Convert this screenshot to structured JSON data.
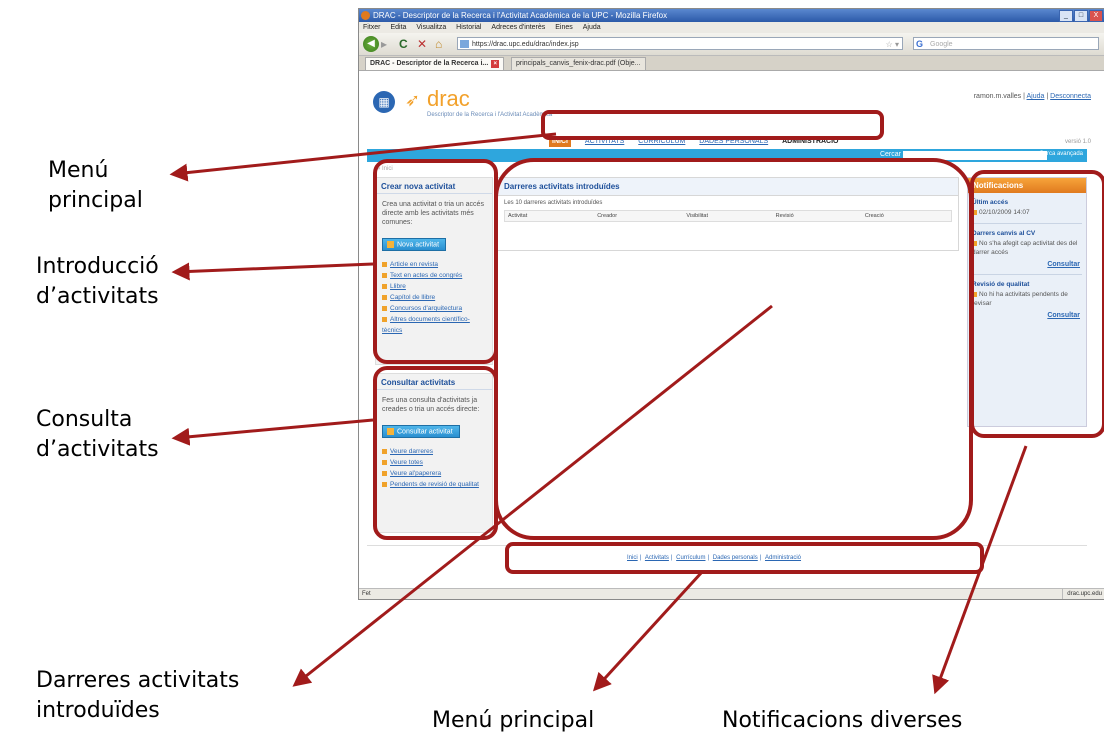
{
  "window": {
    "title": "DRAC - Descriptor de la Recerca i l'Activitat Acadèmica de la UPC - Mozilla Firefox",
    "controls": [
      "_",
      "□",
      "X"
    ]
  },
  "browser_menu": [
    "Fitxer",
    "Edita",
    "Visualitza",
    "Historial",
    "Adreces d'interès",
    "Eines",
    "Ajuda"
  ],
  "url": "https://drac.upc.edu/drac/index.jsp",
  "search_placeholder": "Google",
  "tabs": [
    {
      "label": "DRAC - Descriptor de la Recerca i..."
    },
    {
      "label": "principals_canvis_fenix-drac.pdf (Obje..."
    }
  ],
  "site": {
    "logo_text": "drac",
    "logo_subtitle": "Descriptor de la Recerca i l'Activitat Acadèmica",
    "top_links": {
      "user": "ramon.m.valles",
      "help": "Ajuda",
      "logout": "Desconnecta"
    },
    "nav": [
      "INICI",
      "ACTIVITATS",
      "CURRÍCULUM",
      "DADES PERSONALS",
      "ADMINISTRACIÓ"
    ],
    "version": "versió 1.0",
    "search_label": "Cercar",
    "search_advanced": "Cerca avançada",
    "breadcrumb": "Inici"
  },
  "create_box": {
    "title": "Crear nova activitat",
    "text": "Crea una activitat o tria un accés directe amb les activitats més comunes:",
    "button": "Nova activitat",
    "links": [
      "Article en revista",
      "Text en actes de congrés",
      "Llibre",
      "Capítol de llibre",
      "Concursos d'arquitectura",
      "Altres documents científico-tècnics"
    ]
  },
  "consult_box": {
    "title": "Consultar activitats",
    "text": "Fes una consulta d'activitats ja creades o tria un accés directe:",
    "button": "Consultar activitat",
    "links": [
      "Veure darreres",
      "Veure totes",
      "Veure al'paperera",
      "Pendents de revisió de qualitat"
    ]
  },
  "main_panel": {
    "title": "Darreres activitats introduïdes",
    "subtitle": "Les 10 darreres activitats introduïdes",
    "columns": [
      "Activitat",
      "Creador",
      "Visibilitat",
      "Revisió",
      "Creació"
    ]
  },
  "notifications": {
    "title": "Notificacions",
    "last_access_title": "Últim accés",
    "last_access_value": "02/10/2009 14:07",
    "cv_title": "Darrers canvis al CV",
    "cv_text": "No s'ha afegit cap activitat des del darrer accés",
    "consult": "Consultar",
    "quality_title": "Revisió de qualitat",
    "quality_text": "No hi ha activitats pendents de revisar",
    "consult2": "Consultar"
  },
  "footer_links": [
    "Inici",
    "Activitats",
    "Currículum",
    "Dades personals",
    "Administració"
  ],
  "status": {
    "left": "Fet",
    "right": "drac.upc.edu"
  },
  "annotations": {
    "menu_principal_left": "Menú principal",
    "introduccio": "Introducció d’activitats",
    "consulta": "Consulta d’activitats",
    "darreres": "Darreres activitats introduïdes",
    "menu_principal_bottom": "Menú principal",
    "notificacions": "Notificacions diverses"
  },
  "colors": {
    "highlight": "#a11b1b",
    "accent_orange": "#e07a1f",
    "accent_blue": "#2ea6dd"
  }
}
